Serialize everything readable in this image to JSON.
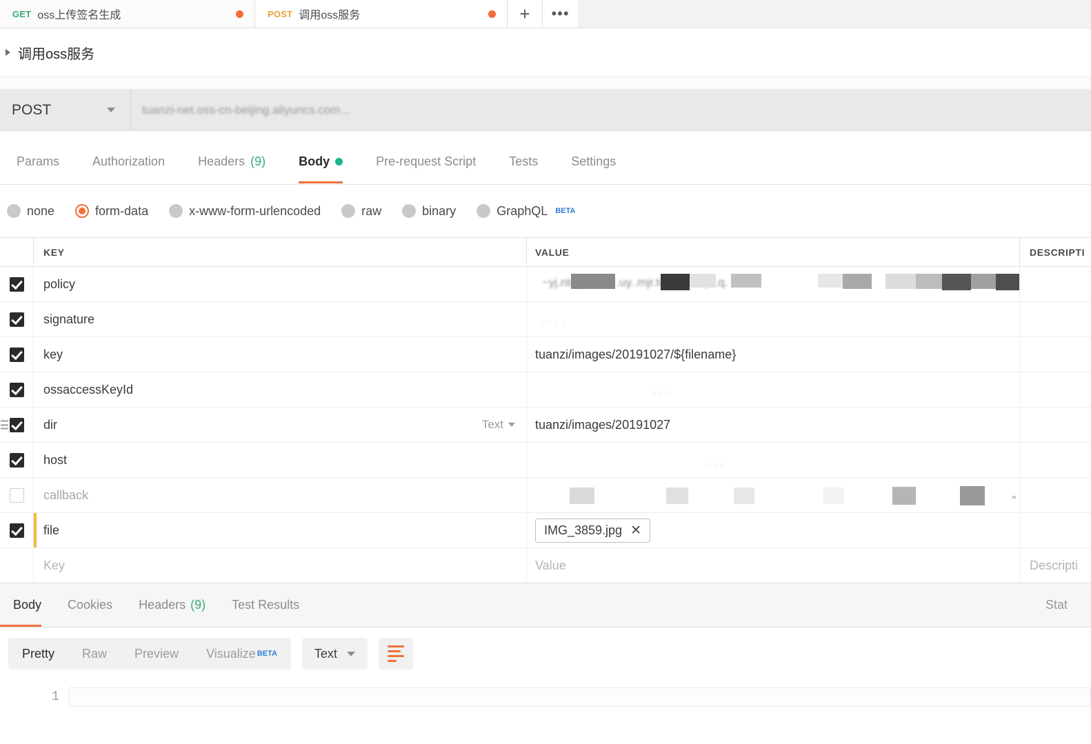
{
  "tabstrip": {
    "tabs": [
      {
        "method": "GET",
        "name": "oss上传签名生成",
        "unsaved": true
      },
      {
        "method": "POST",
        "name": "调用oss服务",
        "unsaved": true
      }
    ],
    "new_tab_label": "+",
    "more_label": "•••"
  },
  "request": {
    "name": "调用oss服务",
    "method": "POST",
    "url_placeholder": "tuanzi-net.oss-cn-beijing.aliyuncs.com...",
    "url_redacted": true,
    "tabs": [
      {
        "label": "Params",
        "active": false
      },
      {
        "label": "Authorization",
        "active": false
      },
      {
        "label": "Headers",
        "count": "(9)",
        "active": false
      },
      {
        "label": "Body",
        "active": true,
        "dot": true
      },
      {
        "label": "Pre-request Script",
        "active": false
      },
      {
        "label": "Tests",
        "active": false
      },
      {
        "label": "Settings",
        "active": false
      }
    ],
    "body_types": [
      {
        "label": "none",
        "selected": false
      },
      {
        "label": "form-data",
        "selected": true
      },
      {
        "label": "x-www-form-urlencoded",
        "selected": false
      },
      {
        "label": "raw",
        "selected": false
      },
      {
        "label": "binary",
        "selected": false
      },
      {
        "label": "GraphQL",
        "selected": false,
        "badge": "BETA"
      }
    ]
  },
  "table": {
    "headers": {
      "key": "KEY",
      "value": "VALUE",
      "description": "DESCRIPTI"
    },
    "rows": [
      {
        "checked": true,
        "key": "policy",
        "value": "",
        "redacted": true,
        "type": null
      },
      {
        "checked": true,
        "key": "signature",
        "value": "",
        "redacted": true,
        "type": null
      },
      {
        "checked": true,
        "key": "key",
        "value": "tuanzi/images/20191027/${filename}",
        "redacted": false,
        "type": null
      },
      {
        "checked": true,
        "key": "ossaccessKeyId",
        "value": "",
        "redacted": true,
        "type": null
      },
      {
        "checked": true,
        "key": "dir",
        "value": "tuanzi/images/20191027",
        "redacted": false,
        "type": "Text",
        "drag": true
      },
      {
        "checked": true,
        "key": "host",
        "value": "",
        "redacted": true,
        "type": null
      },
      {
        "checked": false,
        "key": "callback",
        "value": "",
        "redacted": true,
        "type": null
      },
      {
        "checked": true,
        "key": "file",
        "value": "IMG_3859.jpg",
        "redacted": false,
        "type": null,
        "file_chip": true,
        "focused": true
      }
    ],
    "new_row": {
      "key_placeholder": "Key",
      "value_placeholder": "Value",
      "description_placeholder": "Descripti"
    }
  },
  "response": {
    "tabs": [
      {
        "label": "Body",
        "active": true
      },
      {
        "label": "Cookies",
        "active": false
      },
      {
        "label": "Headers",
        "count": "(9)",
        "active": false
      },
      {
        "label": "Test Results",
        "active": false
      }
    ],
    "status_label": "Stat",
    "view_modes": [
      {
        "label": "Pretty",
        "active": true
      },
      {
        "label": "Raw",
        "active": false
      },
      {
        "label": "Preview",
        "active": false
      },
      {
        "label": "Visualize",
        "active": false,
        "badge": "BETA"
      }
    ],
    "format": "Text",
    "line_numbers": [
      "1"
    ],
    "body_text": ""
  },
  "colors": {
    "accent": "#f0703a",
    "get_verb": "#3aaa7a",
    "post_verb": "#e8a33d",
    "unsaved_dot": "#f26b3a",
    "green_dot": "#1ab38a",
    "focus_bar": "#f5b93c",
    "beta_badge": "#2f7fd6"
  }
}
